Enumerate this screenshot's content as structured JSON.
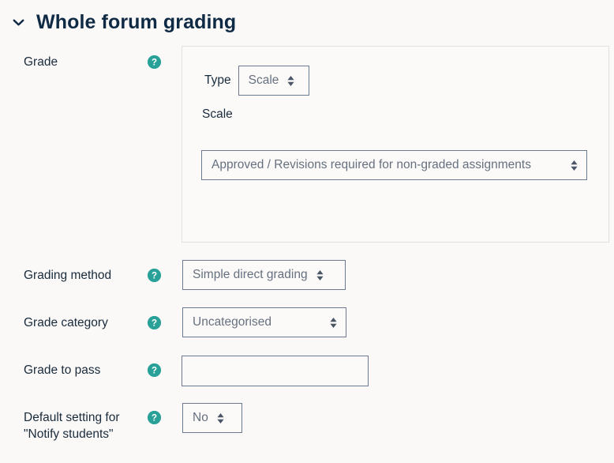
{
  "section": {
    "title": "Whole forum grading",
    "collapse_icon": "chevron-down-icon",
    "expanded": true
  },
  "help_icon_label": "?",
  "colors": {
    "page_background": "#faf9f8",
    "title": "#0f2a44",
    "label": "#1a2b3c",
    "help_icon": "#2aa198",
    "control_border": "#6b7a90",
    "control_text": "#66707e",
    "panel_border": "#e3e0dd"
  },
  "rows": [
    {
      "label": "Grade",
      "help": "?"
    },
    {
      "label": "Grading method",
      "help": "?",
      "value": "Simple direct grading"
    },
    {
      "label": "Grade category",
      "help": "?",
      "value": "Uncategorised"
    },
    {
      "label": "Grade to pass",
      "help": "?",
      "value": "",
      "placeholder": ""
    },
    {
      "label": "Default setting for\n\"Notify students\"",
      "help": "?",
      "value": "No"
    }
  ],
  "grade_panel": {
    "type_label": "Type",
    "type_value": "Scale",
    "scale_label": "Scale",
    "scale_value": "Approved / Revisions required for non-graded assignments"
  }
}
